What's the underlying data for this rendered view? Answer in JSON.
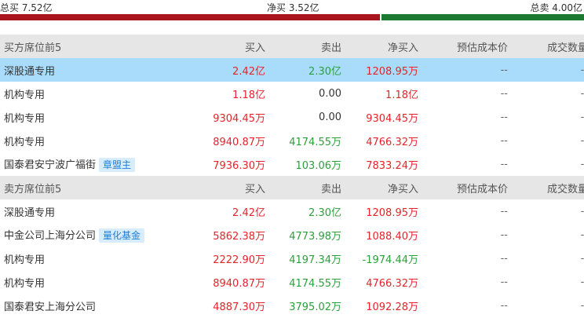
{
  "summary": {
    "total_buy": "总买 7.52亿",
    "net_buy": "净买 3.52亿",
    "total_sell": "总卖 4.00亿",
    "buy_ratio": 0.65,
    "colors": {
      "buy": "#a8151f",
      "sell": "#1d7a33",
      "up": "#e6232b",
      "down": "#2aa13a",
      "highlight": "#a9dcfb"
    }
  },
  "buy_section": {
    "headers": [
      "买方席位前5",
      "买入",
      "卖出",
      "净买入",
      "预估成本价",
      "成交数量"
    ],
    "rows": [
      {
        "name": "深股通专用",
        "tag": "",
        "buy": "2.42亿",
        "sell": "2.30亿",
        "net": "1208.95万",
        "cost": "--",
        "volume": "--",
        "highlight": true
      },
      {
        "name": "机构专用",
        "tag": "",
        "buy": "1.18亿",
        "sell": "0.00",
        "net": "1.18亿",
        "cost": "--",
        "volume": "--"
      },
      {
        "name": "机构专用",
        "tag": "",
        "buy": "9304.45万",
        "sell": "0.00",
        "net": "9304.45万",
        "cost": "--",
        "volume": "--"
      },
      {
        "name": "机构专用",
        "tag": "",
        "buy": "8940.87万",
        "sell": "4174.55万",
        "net": "4766.32万",
        "cost": "--",
        "volume": "--"
      },
      {
        "name": "国泰君安宁波广福街",
        "tag": "章盟主",
        "buy": "7936.30万",
        "sell": "103.06万",
        "net": "7833.24万",
        "cost": "--",
        "volume": "--"
      }
    ]
  },
  "sell_section": {
    "headers": [
      "卖方席位前5",
      "买入",
      "卖出",
      "净买入",
      "预估成本价",
      "成交数量"
    ],
    "rows": [
      {
        "name": "深股通专用",
        "tag": "",
        "buy": "2.42亿",
        "sell": "2.30亿",
        "net": "1208.95万",
        "cost": "--",
        "volume": "--"
      },
      {
        "name": "中金公司上海分公司",
        "tag": "量化基金",
        "buy": "5862.38万",
        "sell": "4773.98万",
        "net": "1088.40万",
        "cost": "--",
        "volume": "--"
      },
      {
        "name": "机构专用",
        "tag": "",
        "buy": "2222.90万",
        "sell": "4197.34万",
        "net": "-1974.44万",
        "cost": "--",
        "volume": "--"
      },
      {
        "name": "机构专用",
        "tag": "",
        "buy": "8940.87万",
        "sell": "4174.55万",
        "net": "4766.32万",
        "cost": "--",
        "volume": "--"
      },
      {
        "name": "国泰君安上海分公司",
        "tag": "",
        "buy": "4887.30万",
        "sell": "3795.02万",
        "net": "1092.28万",
        "cost": "--",
        "volume": "--"
      }
    ]
  }
}
